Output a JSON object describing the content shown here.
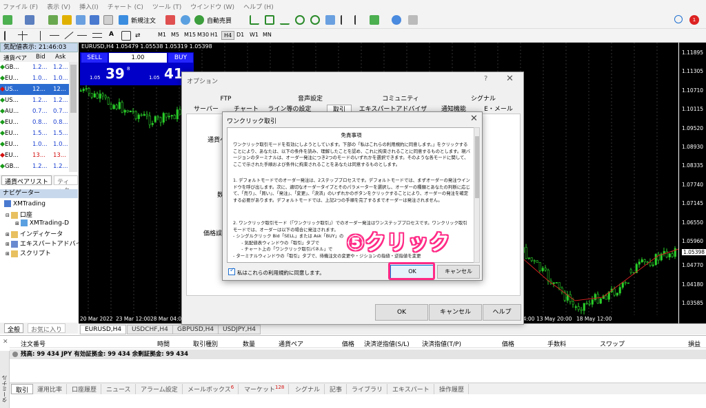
{
  "menu": [
    "ファイル (F)",
    "表示 (V)",
    "挿入(I)",
    "チャート (C)",
    "ツール (T)",
    "ウインドウ (W)",
    "ヘルプ (H)"
  ],
  "toolbar": {
    "new_order": "新規注文",
    "auto_trade": "自動売買",
    "timeframes": [
      "M1",
      "M5",
      "M15",
      "M30",
      "H1",
      "H4",
      "D1",
      "W1",
      "MN"
    ],
    "active_timeframe": "H4",
    "notification_count": "1"
  },
  "market_watch": {
    "title": "気配値表示: 21:46:03",
    "cols": {
      "symbol": "通貨ペア",
      "bid": "Bid",
      "ask": "Ask"
    },
    "rows": [
      {
        "symbol": "GB...",
        "bid": "1.2...",
        "ask": "1.2...",
        "color": "#1a9a1a"
      },
      {
        "symbol": "EU...",
        "bid": "1.0...",
        "ask": "1.0...",
        "color": "#1a9a1a"
      },
      {
        "symbol": "US...",
        "bid": "12...",
        "ask": "12...",
        "color": "#d41010",
        "selected": true
      },
      {
        "symbol": "US...",
        "bid": "1.2...",
        "ask": "1.2...",
        "color": "#1a9a1a"
      },
      {
        "symbol": "AU...",
        "bid": "0.7...",
        "ask": "0.7...",
        "color": "#1a9a1a"
      },
      {
        "symbol": "EU...",
        "bid": "0.8...",
        "ask": "0.8...",
        "color": "#1a9a1a"
      },
      {
        "symbol": "EU...",
        "bid": "1.5...",
        "ask": "1.5...",
        "color": "#1a9a1a"
      },
      {
        "symbol": "EU...",
        "bid": "1.0...",
        "ask": "1.0...",
        "color": "#1a9a1a"
      },
      {
        "symbol": "EU...",
        "bid": "13...",
        "ask": "13...",
        "color": "#d41010",
        "red": true
      },
      {
        "symbol": "GB...",
        "bid": "1.2...",
        "ask": "1.2...",
        "color": "#1a9a1a"
      }
    ],
    "tabs": [
      "通貨ペアリスト",
      "ティック"
    ]
  },
  "navigator": {
    "title": "ナビゲーター",
    "items": [
      "XMTrading",
      "口座",
      "XMTrading-D",
      "インディケータ",
      "エキスパートアドバイザ",
      "スクリプト"
    ],
    "tabs": [
      "全般",
      "お気に入り"
    ]
  },
  "chart": {
    "title": "EURUSD,H4  1.05479 1.05538 1.05319 1.05398",
    "sell": "SELL",
    "buy": "BUY",
    "volume": "1.00",
    "sell_prefix": "1.05",
    "sell_big": "39",
    "sell_sup": "8",
    "buy_prefix": "1.05",
    "buy_big": "41",
    "prices": [
      "1.11895",
      "1.11305",
      "1.10710",
      "1.10115",
      "1.09520",
      "1.08930",
      "1.08335",
      "1.07740",
      "1.07145",
      "1.06550",
      "1.05960",
      "1.05398",
      "1.04770",
      "1.04180",
      "1.03585"
    ],
    "dates": [
      "20 Mar 2022",
      "23 Mar 12:00",
      "28 Mar 04:00",
      "6 May 12:00",
      "11 May 04:00",
      "13 May 20:00",
      "18 May 12:00"
    ],
    "tabs": [
      "EURUSD,H4",
      "USDCHF,H4",
      "GBPUSD,H4",
      "USDJPY,H4"
    ]
  },
  "terminal": {
    "side_label": "ターミナル",
    "cols": [
      "注文番号",
      "時間",
      "取引種別",
      "数量",
      "通貨ペア",
      "価格",
      "決済逆指値(S/L)",
      "決済指値(T/P)",
      "価格",
      "手数料",
      "スワップ",
      "損益"
    ],
    "balance": "残高: 99 434 JPY  有効証拠金: 99 434  余剰証拠金: 99 434",
    "tabs": [
      {
        "label": "取引"
      },
      {
        "label": "運用比率"
      },
      {
        "label": "口座履歴"
      },
      {
        "label": "ニュース"
      },
      {
        "label": "アラーム設定"
      },
      {
        "label": "メールボックス",
        "badge": "6"
      },
      {
        "label": "マーケット",
        "badge": "128"
      },
      {
        "label": "シグナル"
      },
      {
        "label": "記事"
      },
      {
        "label": "ライブラリ"
      },
      {
        "label": "エキスパート"
      },
      {
        "label": "操作履歴"
      }
    ]
  },
  "options": {
    "title": "オプション",
    "help": "?",
    "close": "✕",
    "tabs_row1": [
      "FTP",
      "音声設定",
      "コミュニティ",
      "シグナル"
    ],
    "tabs_row2": [
      "サーバー",
      "チャート",
      "ライン等の設定",
      "取引",
      "エキスパートアドバイザ",
      "通知機能",
      "E・メール"
    ],
    "labels": [
      "通貨ペ",
      "数",
      "価格誤"
    ],
    "ok": "OK",
    "cancel": "キャンセル",
    "help_btn": "ヘルプ"
  },
  "one_click": {
    "title": "ワンクリック取引",
    "close": "✕",
    "heading": "免責事項",
    "paragraphs": [
      "ワンクリック取引モードを有効にしようとしています。下部の「私はこれらの利用規約に同意します。」をクリックすることにより、あなたは、以下の条件を読み、理解したことを認め、これに拘束されることに同意するものとします。現バージョンのターミナルは、オーダー発注につき2つのモードのいずれかを選択できます。そのような各モードに関して、ここで示された手順および条件に拘束されることをあなたは同意するものとします。",
      "1. デフォルトモードでのオーダー発注は、2ステッププロセスです。デフォルトモードでは、まずオーダーの発注ウインドウを呼び出します。次に、適切なオーダータイプとそのパラメーターを選択し、オーダーの種類とあなたの判断に応じて、「売り」、「買い」、「発注」、「変更」、「決済」のいずれかのボタンをクリックすることにより、オーダーの発注を確定する必要があります。デフォルトモードでは、上記2つの手順を完了するまでオーダーは発注されません。",
      "2. ワンクリック取引モード（「ワンクリック取引」）でのオーダー発注はワンステッププロセスです。ワンクリック取引モードでは、オーダーは以下の場合に発注されます。\n- シングルクリック Bid「SELL」または Ask「BUY」の\n      - 気配値表ウィンドウの「取引」タブで\n      - チャート上の「ワンクリック取引パネル」で\n- ターミナルウィンドウの「取引」タブで、待機注文の変更や・ジションの指値・逆指値を変更"
    ],
    "agree": "私はこれらの利用規約に同意します。",
    "ok": "OK",
    "cancel": "キャンセル"
  },
  "annotation": "⑤クリック"
}
